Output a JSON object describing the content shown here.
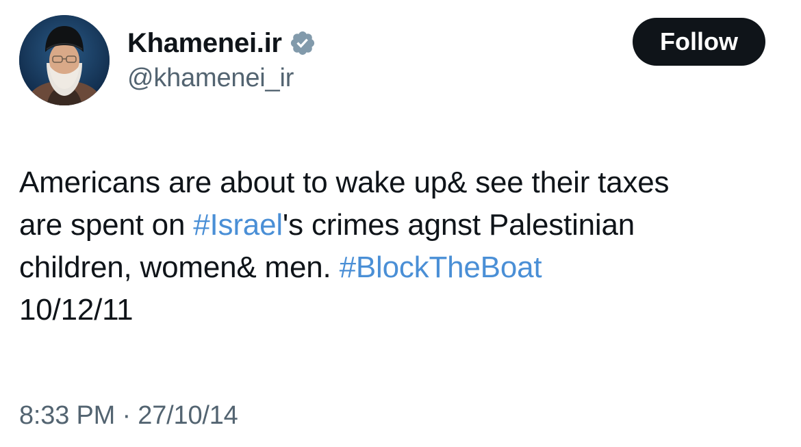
{
  "author": {
    "display_name": "Khamenei.ir",
    "handle": "@khamenei_ir",
    "verified_icon": "verified-badge-icon",
    "verified_color": "#829aab"
  },
  "actions": {
    "follow_label": "Follow"
  },
  "tweet": {
    "line1": "Americans are about to wake up& see their taxes",
    "line2_prefix": "are spent on ",
    "line2_hashtag": "#Israel",
    "line2_suffix": "'s crimes agnst Palestinian",
    "line3_prefix": "children, women& men. ",
    "line3_hashtag": "#BlockTheBoat",
    "line4": "10/12/11",
    "hashtag_color": "#4a8fd6"
  },
  "meta": {
    "time": "8:33 PM",
    "separator": " · ",
    "date": "27/10/14"
  }
}
